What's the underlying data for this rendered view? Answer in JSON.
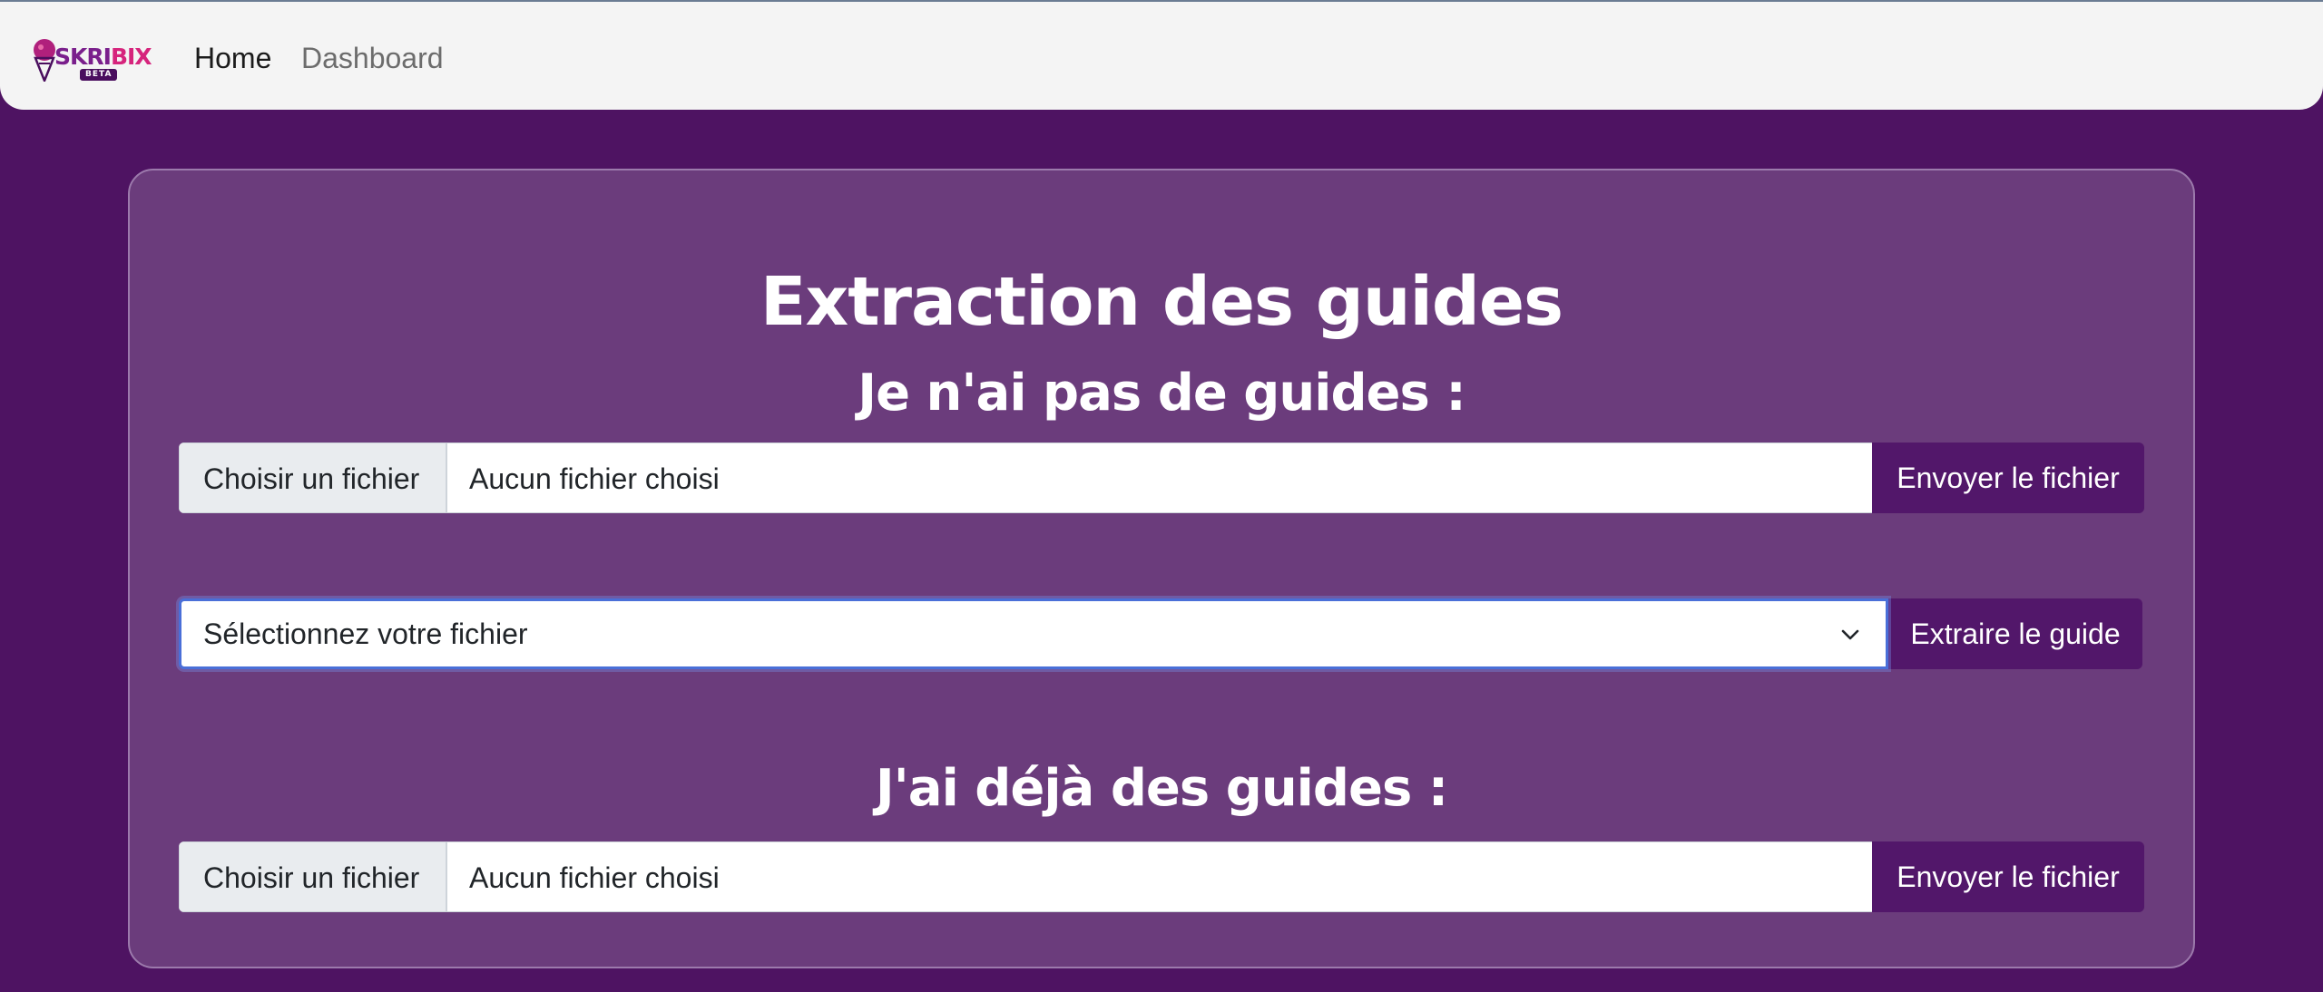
{
  "navbar": {
    "logo": {
      "text_a": "SKRI",
      "text_b": "BIX",
      "badge": "BETA"
    },
    "links": [
      {
        "label": "Home"
      },
      {
        "label": "Dashboard"
      }
    ]
  },
  "card": {
    "title": "Extraction des guides",
    "section1_title": "Je n'ai pas de guides :",
    "upload1": {
      "choose_label": "Choisir un fichier",
      "file_name": "Aucun fichier choisi",
      "submit_label": "Envoyer le fichier"
    },
    "select": {
      "selected": "Sélectionnez votre fichier",
      "button_label": "Extraire le guide"
    },
    "section2_title": "J'ai déjà des guides :",
    "upload2": {
      "choose_label": "Choisir un fichier",
      "file_name": "Aucun fichier choisi",
      "submit_label": "Envoyer le fichier"
    }
  },
  "colors": {
    "background": "#4e1362",
    "card": "#6b3c7c",
    "button": "#52176a",
    "focus_border": "#4a6fd8"
  }
}
